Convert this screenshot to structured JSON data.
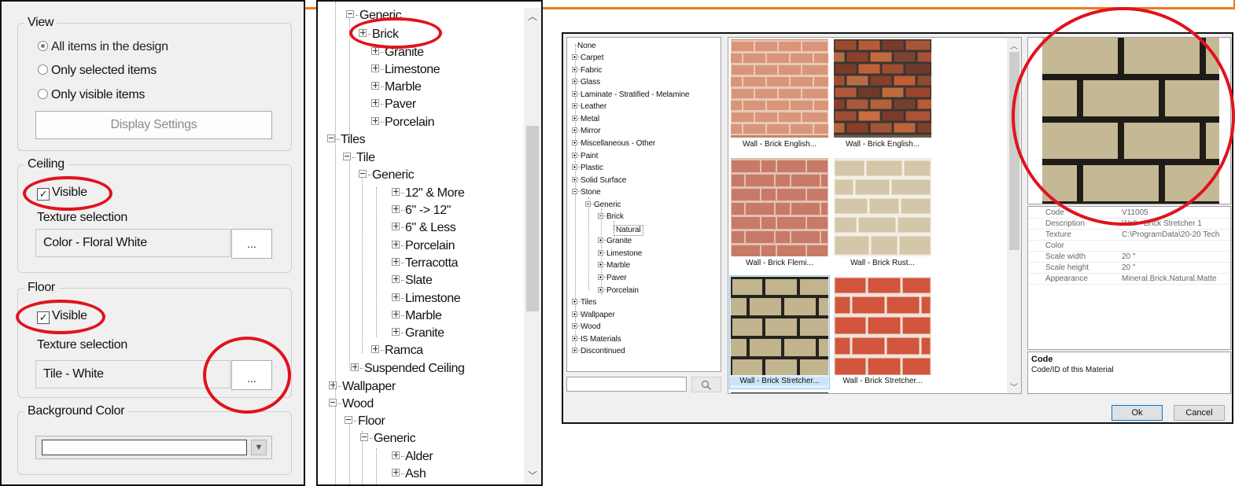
{
  "view_group": {
    "title": "View",
    "options": [
      "All items in the design",
      "Only selected items",
      "Only visible items"
    ],
    "display_settings": "Display Settings"
  },
  "ceiling_group": {
    "title": "Ceiling",
    "visible_label": "Visible",
    "visible_checked": true,
    "texture_label": "Texture selection",
    "texture_value": "Color - Floral White",
    "browse": "..."
  },
  "floor_group": {
    "title": "Floor",
    "visible_label": "Visible",
    "visible_checked": true,
    "texture_label": "Texture selection",
    "texture_value": "Tile - White",
    "browse": "..."
  },
  "background_group": {
    "title": "Background Color",
    "value": ""
  },
  "tree": {
    "items": [
      "Generic",
      "Brick",
      "Granite",
      "Limestone",
      "Marble",
      "Paver",
      "Porcelain",
      "Tiles",
      "Tile",
      "Generic",
      "12\" & More",
      "6\" -> 12\"",
      "6\" & Less",
      "Porcelain",
      "Terracotta",
      "Slate",
      "Limestone",
      "Marble",
      "Granite",
      "Ramca",
      "Suspended Ceiling",
      "Wallpaper",
      "Wood",
      "Floor",
      "Generic",
      "Alder",
      "Ash"
    ]
  },
  "dialog": {
    "categories": [
      "None",
      "Carpet",
      "Fabric",
      "Glass",
      "Laminate - Stratified - Melamine",
      "Leather",
      "Metal",
      "Mirror",
      "Miscellaneous - Other",
      "Paint",
      "Plastic",
      "Solid Surface",
      "Stone",
      "Generic",
      "Brick",
      "Natural",
      "Granite",
      "Limestone",
      "Marble",
      "Paver",
      "Porcelain",
      "Tiles",
      "Wallpaper",
      "Wood",
      "IS Materials",
      "Discontinued"
    ],
    "search_value": "",
    "thumbnails": [
      "Wall - Brick English...",
      "Wall - Brick English...",
      "Wall - Brick Flemi...",
      "Wall - Brick Rust...",
      "Wall - Brick Stretcher...",
      "Wall - Brick Stretcher..."
    ],
    "properties": [
      {
        "key": "Code",
        "value": "V11005"
      },
      {
        "key": "Description",
        "value": "Wall - Brick Stretcher 1"
      },
      {
        "key": "Texture",
        "value": "C:\\ProgramData\\20-20 Tech"
      },
      {
        "key": "Color",
        "value": ""
      },
      {
        "key": "Scale width",
        "value": "20 \""
      },
      {
        "key": "Scale height",
        "value": "20 \""
      },
      {
        "key": "Appearance",
        "value": "Mineral.Brick.Natural.Matte"
      }
    ],
    "desc_title": "Code",
    "desc_text": "Code/ID of this Material",
    "ok": "Ok",
    "cancel": "Cancel"
  },
  "colors": {
    "annotation_red": "#e0131e",
    "frame_orange": "#f07a1a",
    "selection_blue": "#cce4f7"
  }
}
